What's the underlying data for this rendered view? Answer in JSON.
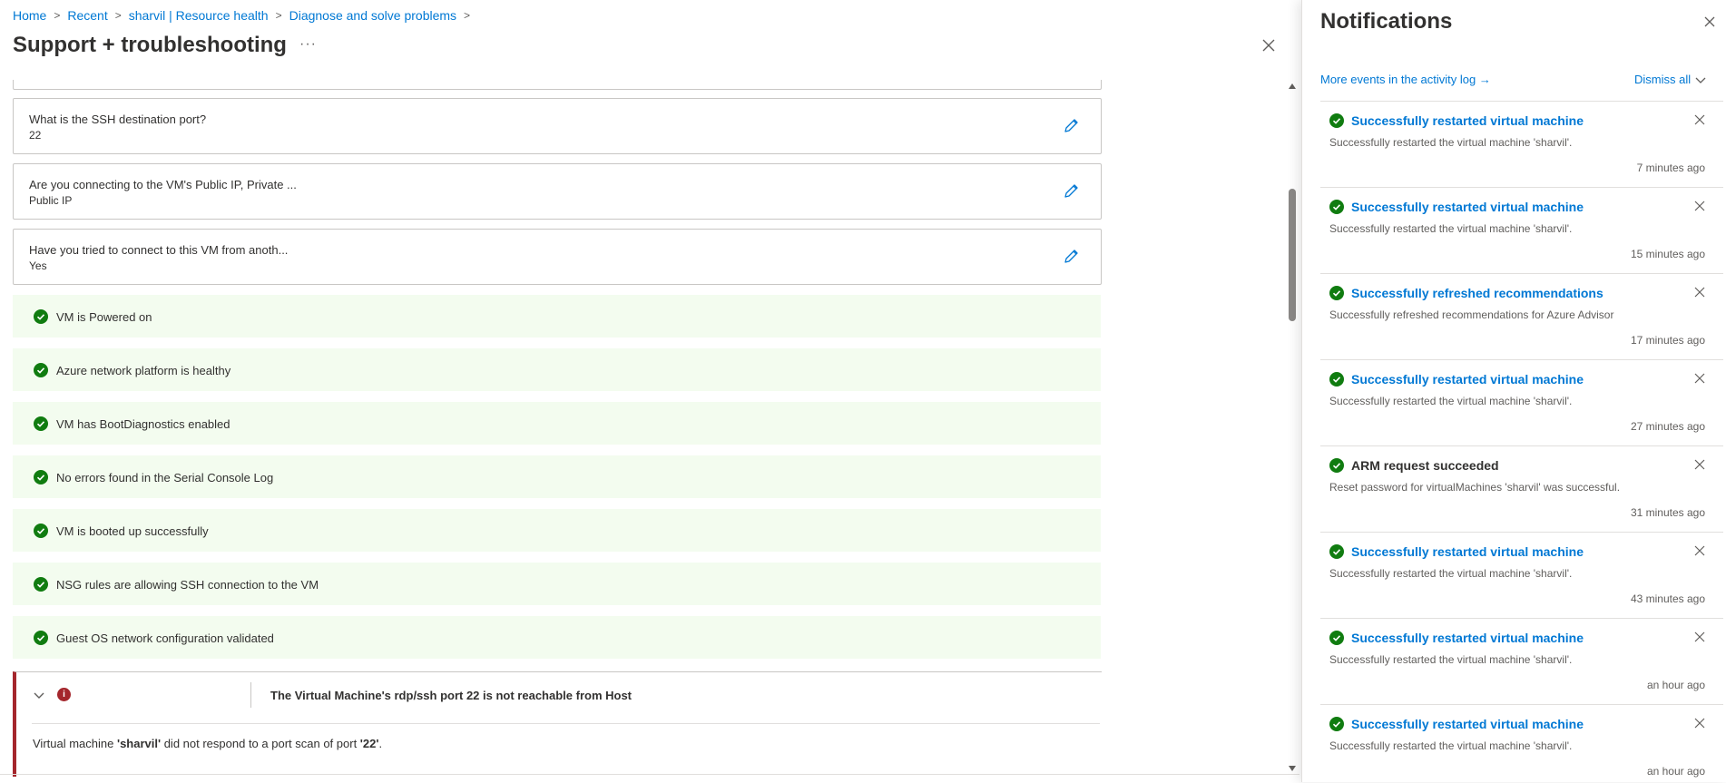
{
  "breadcrumb": {
    "items": [
      "Home",
      "Recent",
      "sharvil | Resource health",
      "Diagnose and solve problems"
    ]
  },
  "page": {
    "title": "Support + troubleshooting",
    "more_label": "···"
  },
  "questions": [
    {
      "question": "What is the SSH destination port?",
      "answer": "22"
    },
    {
      "question": "Are you connecting to the VM's Public IP, Private ...",
      "answer": "Public IP"
    },
    {
      "question": "Have you tried to connect to this VM from anoth...",
      "answer": "Yes"
    }
  ],
  "checks": [
    "VM is Powered on",
    "Azure network platform is healthy",
    "VM has BootDiagnostics enabled",
    "No errors found in the Serial Console Log",
    "VM is booted up successfully",
    "NSG rules are allowing SSH connection to the VM",
    "Guest OS network configuration validated"
  ],
  "error": {
    "title": "The Virtual Machine's rdp/ssh port 22 is not reachable from Host",
    "desc_prefix": "Virtual machine ",
    "desc_vm": "'sharvil'",
    "desc_middle": " did not respond to a port scan of port ",
    "desc_port": "'22'",
    "desc_suffix": "."
  },
  "notifications": {
    "title": "Notifications",
    "more_events": "More events in the activity log →",
    "dismiss_all": "Dismiss all",
    "items": [
      {
        "title": "Successfully restarted virtual machine",
        "body": "Successfully restarted the virtual machine 'sharvil'.",
        "time": "7 minutes ago",
        "link": true
      },
      {
        "title": "Successfully restarted virtual machine",
        "body": "Successfully restarted the virtual machine 'sharvil'.",
        "time": "15 minutes ago",
        "link": true
      },
      {
        "title": "Successfully refreshed recommendations",
        "body": "Successfully refreshed recommendations for Azure Advisor",
        "time": "17 minutes ago",
        "link": true
      },
      {
        "title": "Successfully restarted virtual machine",
        "body": "Successfully restarted the virtual machine 'sharvil'.",
        "time": "27 minutes ago",
        "link": true
      },
      {
        "title": "ARM request succeeded",
        "body": "Reset password for virtualMachines 'sharvil' was successful.",
        "time": "31 minutes ago",
        "link": false
      },
      {
        "title": "Successfully restarted virtual machine",
        "body": "Successfully restarted the virtual machine 'sharvil'.",
        "time": "43 minutes ago",
        "link": true
      },
      {
        "title": "Successfully restarted virtual machine",
        "body": "Successfully restarted the virtual machine 'sharvil'.",
        "time": "an hour ago",
        "link": true
      },
      {
        "title": "Successfully restarted virtual machine",
        "body": "Successfully restarted the virtual machine 'sharvil'.",
        "time": "an hour ago",
        "link": true
      }
    ]
  },
  "colors": {
    "accent": "#0078d4",
    "success": "#107c10",
    "error": "#a4262c",
    "success_bg": "#f3fcef"
  },
  "icons": {
    "check": "check-circle-icon",
    "edit": "pencil-icon",
    "close": "close-icon",
    "error": "error-info-icon",
    "chevron": "chevron-down-icon"
  }
}
